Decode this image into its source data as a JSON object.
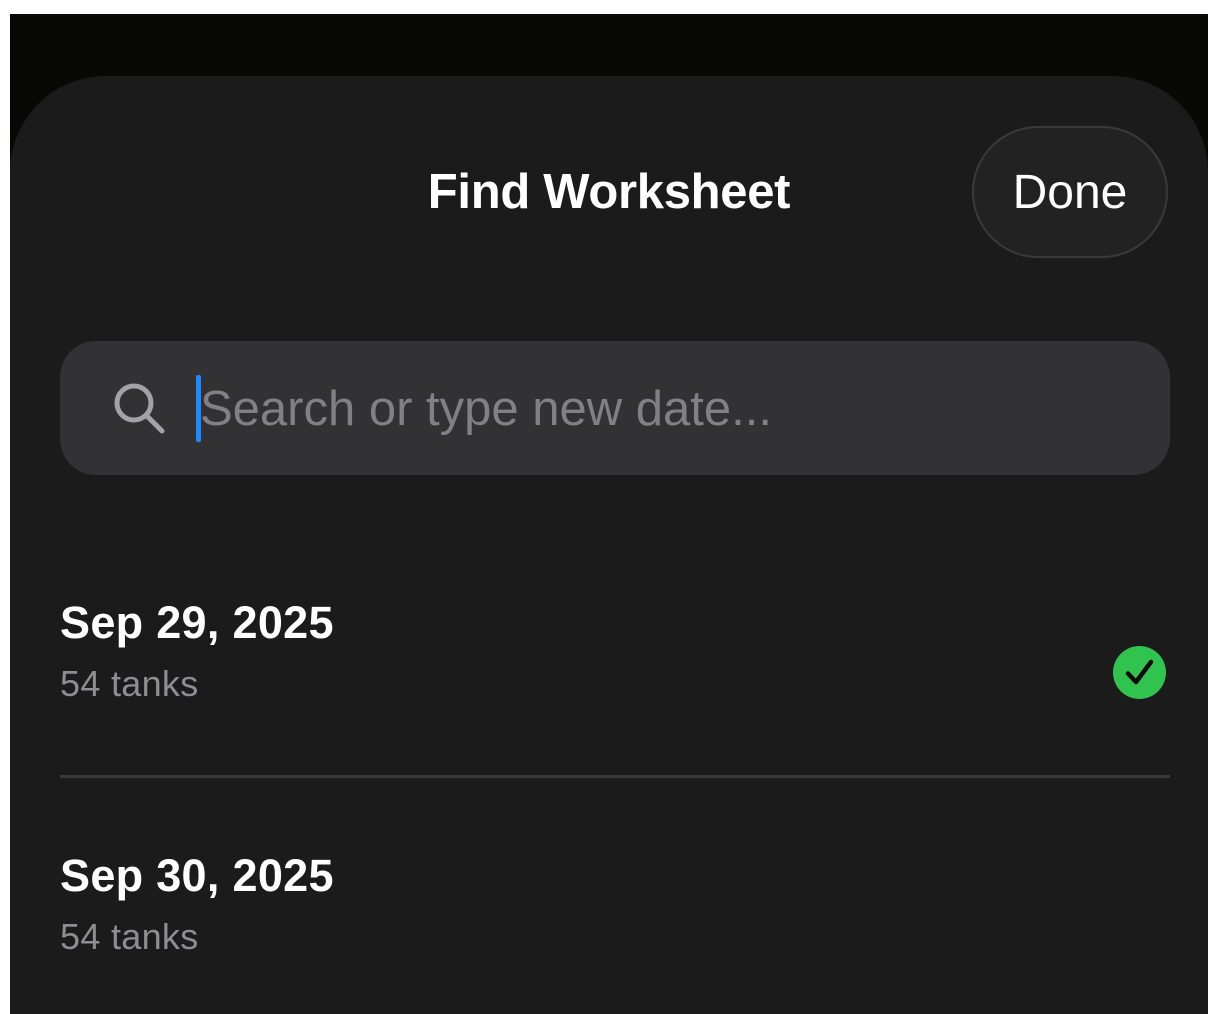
{
  "header": {
    "title": "Find Worksheet",
    "done_label": "Done"
  },
  "search": {
    "placeholder": "Search or type new date...",
    "value": "",
    "caret_color": "#1e88ff"
  },
  "worksheets": [
    {
      "date": "Sep 29, 2025",
      "subtitle": "54 tanks",
      "selected": true
    },
    {
      "date": "Sep 30, 2025",
      "subtitle": "54 tanks",
      "selected": false
    }
  ],
  "colors": {
    "sheet_background": "#1b1b1c",
    "search_background": "#323234",
    "selected_check": "#30c44f",
    "secondary_text": "#8d8d92"
  },
  "icons": {
    "search": "search-icon",
    "selected": "checkmark-circle-icon"
  }
}
